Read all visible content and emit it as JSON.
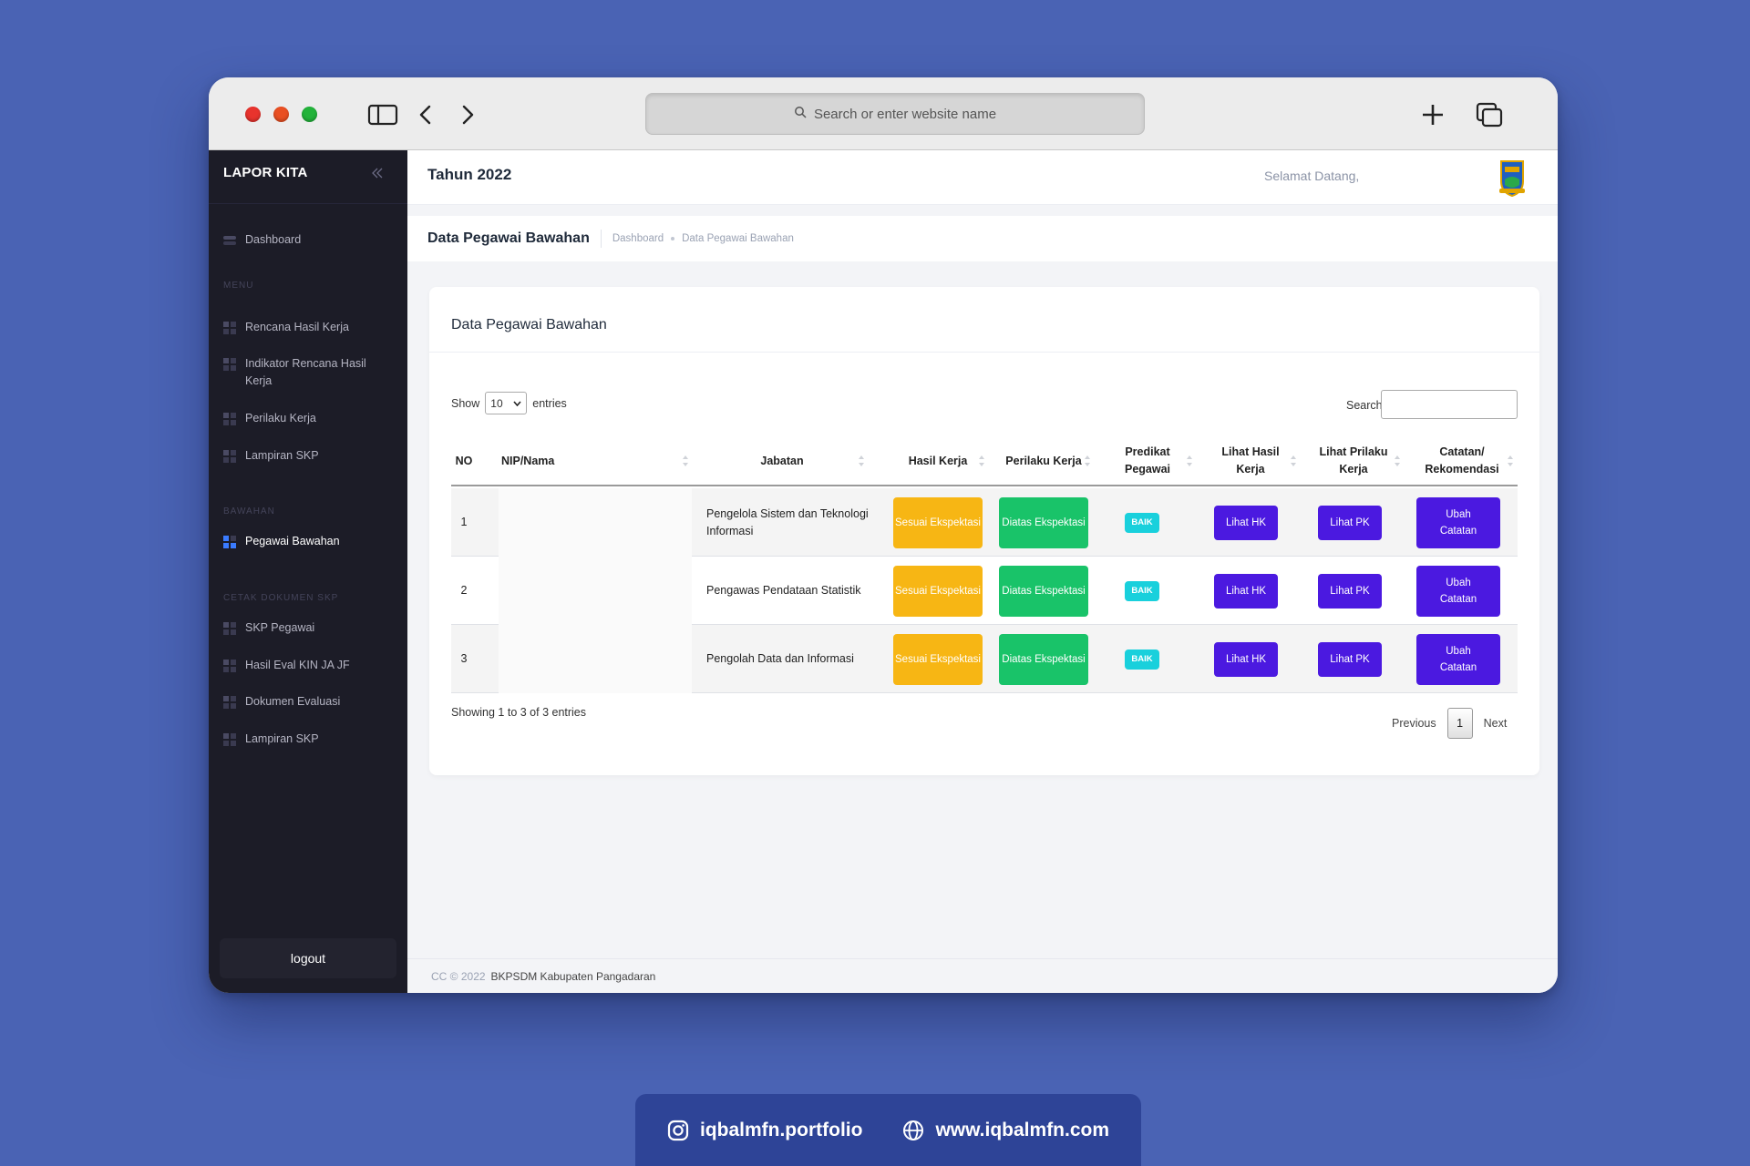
{
  "browser": {
    "address_placeholder": "Search or enter website name"
  },
  "sidebar": {
    "brand": "LAPOR KITA",
    "dashboard": "Dashboard",
    "section_menu": "MENU",
    "menu_items": [
      "Rencana Hasil Kerja",
      "Indikator Rencana Hasil Kerja",
      "Perilaku Kerja",
      "Lampiran SKP"
    ],
    "section_bawahan": "BAWAHAN",
    "bawahan_items": [
      "Pegawai Bawahan"
    ],
    "section_cetak": "CETAK DOKUMEN SKP",
    "cetak_items": [
      "SKP Pegawai",
      "Hasil Eval KIN JA JF",
      "Dokumen Evaluasi",
      "Lampiran SKP"
    ],
    "logout": "logout"
  },
  "topbar": {
    "year": "Tahun 2022",
    "welcome": "Selamat Datang,"
  },
  "subheader": {
    "title": "Data Pegawai Bawahan",
    "breadcrumb": [
      "Dashboard",
      "Data Pegawai Bawahan"
    ]
  },
  "card": {
    "title": "Data Pegawai Bawahan",
    "show_label": "Show",
    "entries_value": "10",
    "entries_label": "entries",
    "search_label": "Search:",
    "columns": [
      "NO",
      "NIP/Nama",
      "Jabatan",
      "Hasil Kerja",
      "Perilaku Kerja",
      "Predikat Pegawai",
      "Lihat Hasil Kerja",
      "Lihat Prilaku Kerja",
      "Catatan/ Rekomendasi"
    ],
    "rows": [
      {
        "no": "1",
        "nip": "",
        "jabatan": "Pengelola Sistem dan Teknologi Informasi",
        "hasil": "Sesuai Ekspektasi",
        "perilaku": "Diatas Ekspektasi",
        "predikat": "BAIK",
        "lihat_hk": "Lihat HK",
        "lihat_pk": "Lihat PK",
        "catatan": "Ubah Catatan"
      },
      {
        "no": "2",
        "nip": "",
        "jabatan": "Pengawas Pendataan Statistik",
        "hasil": "Sesuai Ekspektasi",
        "perilaku": "Diatas Ekspektasi",
        "predikat": "BAIK",
        "lihat_hk": "Lihat HK",
        "lihat_pk": "Lihat PK",
        "catatan": "Ubah Catatan"
      },
      {
        "no": "3",
        "nip": "",
        "jabatan": "Pengolah Data dan Informasi",
        "hasil": "Sesuai Ekspektasi",
        "perilaku": "Diatas Ekspektasi",
        "predikat": "BAIK",
        "lihat_hk": "Lihat HK",
        "lihat_pk": "Lihat PK",
        "catatan": "Ubah Catatan"
      }
    ],
    "info": "Showing 1 to 3 of 3 entries",
    "previous": "Previous",
    "page": "1",
    "next": "Next"
  },
  "footer": {
    "cc": "CC © 2022",
    "org": "BKPSDM Kabupaten Pangadaran"
  },
  "credit": {
    "instagram": "iqbalmfn.portfolio",
    "website": "www.iqbalmfn.com"
  },
  "colors": {
    "background": "#4a63b4",
    "sidebar": "#1c1c27",
    "yellow": "#f7b614",
    "green": "#19c369",
    "cyan": "#19d0dc",
    "purple": "#4b19e0",
    "credit_bar": "#2e4497"
  }
}
